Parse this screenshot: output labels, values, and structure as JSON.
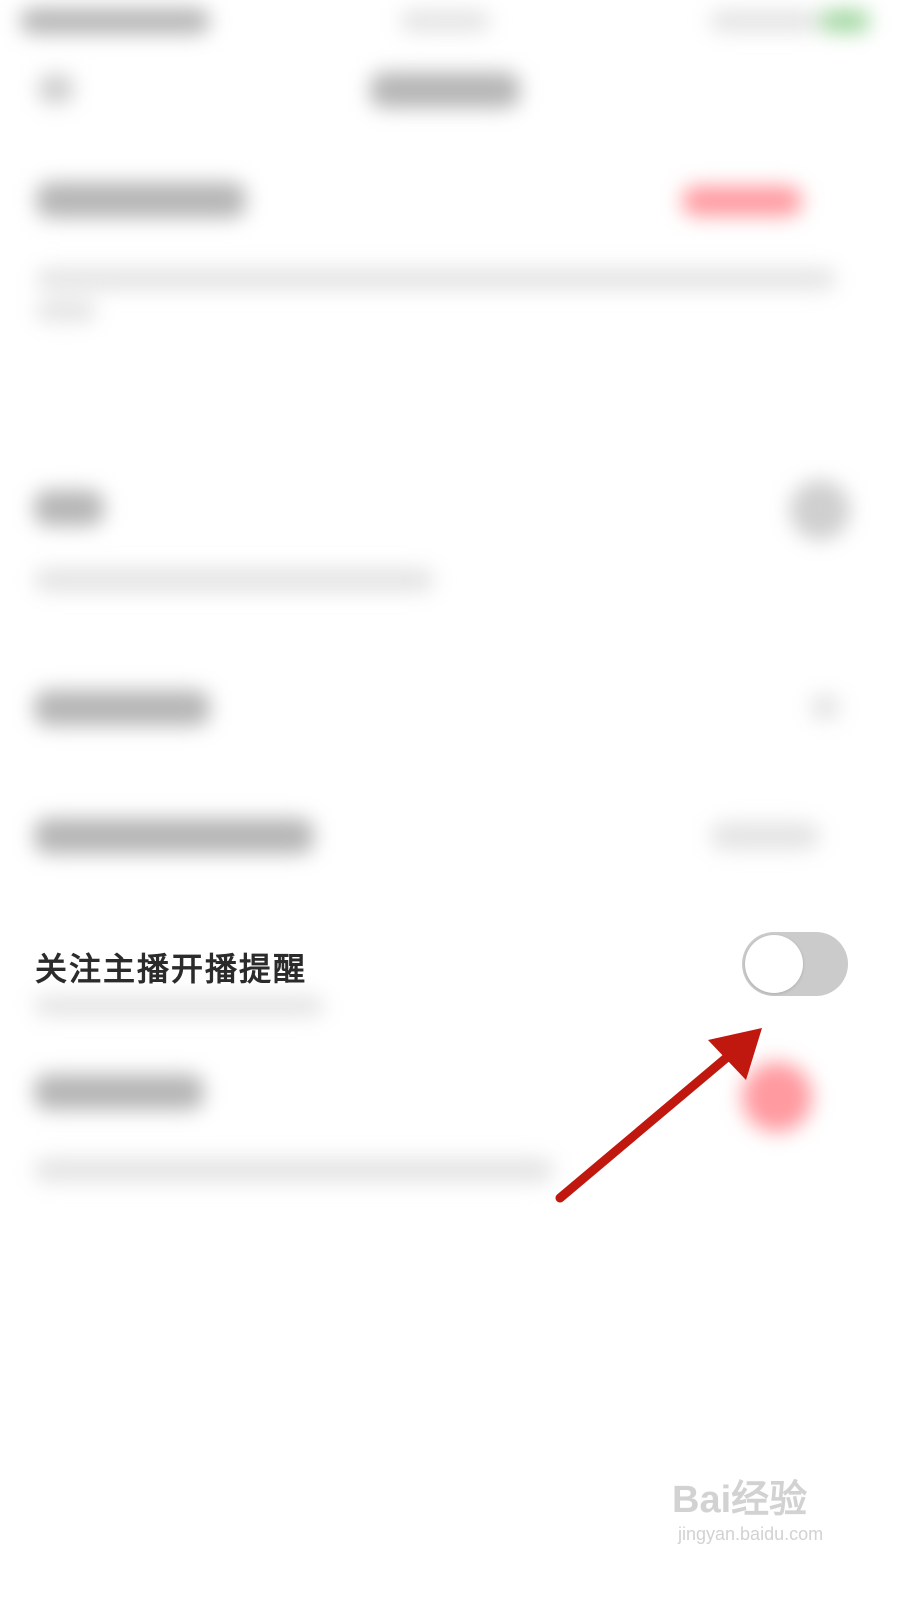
{
  "settings": {
    "follow_streamer_reminder": {
      "label": "关注主播开播提醒",
      "enabled": false
    }
  },
  "watermark": {
    "brand": "Bai经验",
    "url": "jingyan.baidu.com"
  },
  "colors": {
    "toggle_off_track": "#cbcbcb",
    "annotation_arrow": "#c0170f"
  }
}
